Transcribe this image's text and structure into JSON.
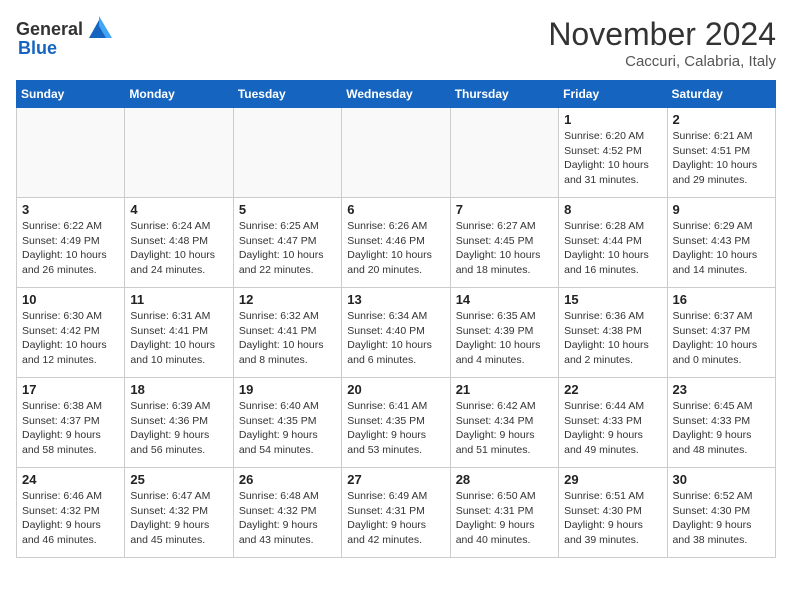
{
  "header": {
    "logo_general": "General",
    "logo_blue": "Blue",
    "month_title": "November 2024",
    "subtitle": "Caccuri, Calabria, Italy"
  },
  "days_of_week": [
    "Sunday",
    "Monday",
    "Tuesday",
    "Wednesday",
    "Thursday",
    "Friday",
    "Saturday"
  ],
  "weeks": [
    [
      {
        "day": "",
        "info": ""
      },
      {
        "day": "",
        "info": ""
      },
      {
        "day": "",
        "info": ""
      },
      {
        "day": "",
        "info": ""
      },
      {
        "day": "",
        "info": ""
      },
      {
        "day": "1",
        "info": "Sunrise: 6:20 AM\nSunset: 4:52 PM\nDaylight: 10 hours and 31 minutes."
      },
      {
        "day": "2",
        "info": "Sunrise: 6:21 AM\nSunset: 4:51 PM\nDaylight: 10 hours and 29 minutes."
      }
    ],
    [
      {
        "day": "3",
        "info": "Sunrise: 6:22 AM\nSunset: 4:49 PM\nDaylight: 10 hours and 26 minutes."
      },
      {
        "day": "4",
        "info": "Sunrise: 6:24 AM\nSunset: 4:48 PM\nDaylight: 10 hours and 24 minutes."
      },
      {
        "day": "5",
        "info": "Sunrise: 6:25 AM\nSunset: 4:47 PM\nDaylight: 10 hours and 22 minutes."
      },
      {
        "day": "6",
        "info": "Sunrise: 6:26 AM\nSunset: 4:46 PM\nDaylight: 10 hours and 20 minutes."
      },
      {
        "day": "7",
        "info": "Sunrise: 6:27 AM\nSunset: 4:45 PM\nDaylight: 10 hours and 18 minutes."
      },
      {
        "day": "8",
        "info": "Sunrise: 6:28 AM\nSunset: 4:44 PM\nDaylight: 10 hours and 16 minutes."
      },
      {
        "day": "9",
        "info": "Sunrise: 6:29 AM\nSunset: 4:43 PM\nDaylight: 10 hours and 14 minutes."
      }
    ],
    [
      {
        "day": "10",
        "info": "Sunrise: 6:30 AM\nSunset: 4:42 PM\nDaylight: 10 hours and 12 minutes."
      },
      {
        "day": "11",
        "info": "Sunrise: 6:31 AM\nSunset: 4:41 PM\nDaylight: 10 hours and 10 minutes."
      },
      {
        "day": "12",
        "info": "Sunrise: 6:32 AM\nSunset: 4:41 PM\nDaylight: 10 hours and 8 minutes."
      },
      {
        "day": "13",
        "info": "Sunrise: 6:34 AM\nSunset: 4:40 PM\nDaylight: 10 hours and 6 minutes."
      },
      {
        "day": "14",
        "info": "Sunrise: 6:35 AM\nSunset: 4:39 PM\nDaylight: 10 hours and 4 minutes."
      },
      {
        "day": "15",
        "info": "Sunrise: 6:36 AM\nSunset: 4:38 PM\nDaylight: 10 hours and 2 minutes."
      },
      {
        "day": "16",
        "info": "Sunrise: 6:37 AM\nSunset: 4:37 PM\nDaylight: 10 hours and 0 minutes."
      }
    ],
    [
      {
        "day": "17",
        "info": "Sunrise: 6:38 AM\nSunset: 4:37 PM\nDaylight: 9 hours and 58 minutes."
      },
      {
        "day": "18",
        "info": "Sunrise: 6:39 AM\nSunset: 4:36 PM\nDaylight: 9 hours and 56 minutes."
      },
      {
        "day": "19",
        "info": "Sunrise: 6:40 AM\nSunset: 4:35 PM\nDaylight: 9 hours and 54 minutes."
      },
      {
        "day": "20",
        "info": "Sunrise: 6:41 AM\nSunset: 4:35 PM\nDaylight: 9 hours and 53 minutes."
      },
      {
        "day": "21",
        "info": "Sunrise: 6:42 AM\nSunset: 4:34 PM\nDaylight: 9 hours and 51 minutes."
      },
      {
        "day": "22",
        "info": "Sunrise: 6:44 AM\nSunset: 4:33 PM\nDaylight: 9 hours and 49 minutes."
      },
      {
        "day": "23",
        "info": "Sunrise: 6:45 AM\nSunset: 4:33 PM\nDaylight: 9 hours and 48 minutes."
      }
    ],
    [
      {
        "day": "24",
        "info": "Sunrise: 6:46 AM\nSunset: 4:32 PM\nDaylight: 9 hours and 46 minutes."
      },
      {
        "day": "25",
        "info": "Sunrise: 6:47 AM\nSunset: 4:32 PM\nDaylight: 9 hours and 45 minutes."
      },
      {
        "day": "26",
        "info": "Sunrise: 6:48 AM\nSunset: 4:32 PM\nDaylight: 9 hours and 43 minutes."
      },
      {
        "day": "27",
        "info": "Sunrise: 6:49 AM\nSunset: 4:31 PM\nDaylight: 9 hours and 42 minutes."
      },
      {
        "day": "28",
        "info": "Sunrise: 6:50 AM\nSunset: 4:31 PM\nDaylight: 9 hours and 40 minutes."
      },
      {
        "day": "29",
        "info": "Sunrise: 6:51 AM\nSunset: 4:30 PM\nDaylight: 9 hours and 39 minutes."
      },
      {
        "day": "30",
        "info": "Sunrise: 6:52 AM\nSunset: 4:30 PM\nDaylight: 9 hours and 38 minutes."
      }
    ]
  ]
}
